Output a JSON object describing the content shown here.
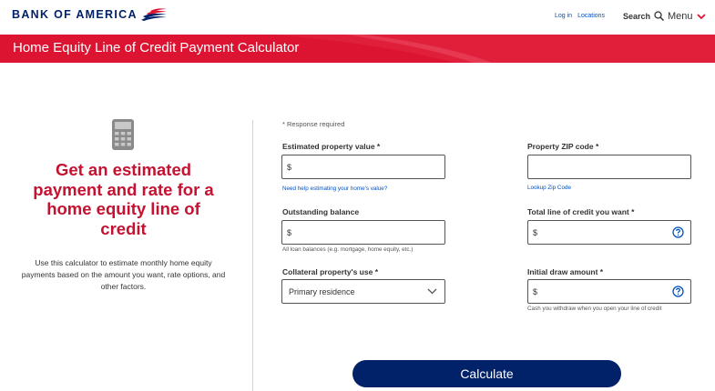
{
  "header": {
    "logo_text": "BANK OF AMERICA",
    "login": "Log in",
    "locations": "Locations",
    "search": "Search",
    "menu": "Menu"
  },
  "banner": {
    "title": "Home Equity Line of Credit Payment Calculator"
  },
  "left": {
    "headline": "Get an estimated payment and rate for a home equity line of credit",
    "description": "Use this calculator to estimate monthly home equity payments based on the amount you want, rate options, and other factors."
  },
  "form": {
    "required_note": "* Response required",
    "property_value": {
      "label": "Estimated property value *",
      "prefix": "$",
      "help_link": "Need help estimating your home's value?"
    },
    "zip_code": {
      "label": "Property ZIP code *",
      "help_link": "Lookup Zip Code"
    },
    "outstanding_balance": {
      "label": "Outstanding balance",
      "prefix": "$",
      "helper": "All loan balances (e.g. mortgage, home equity, etc.)"
    },
    "total_line": {
      "label": "Total line of credit you want *",
      "prefix": "$"
    },
    "collateral_use": {
      "label": "Collateral property's use *",
      "selected": "Primary residence"
    },
    "initial_draw": {
      "label": "Initial draw amount *",
      "prefix": "$",
      "helper": "Cash you withdraw when you open your line of credit"
    },
    "calculate_label": "Calculate"
  },
  "colors": {
    "brand_red": "#dc1431",
    "brand_navy": "#012169",
    "link_blue": "#0052c2",
    "headline_red": "#c41230"
  }
}
